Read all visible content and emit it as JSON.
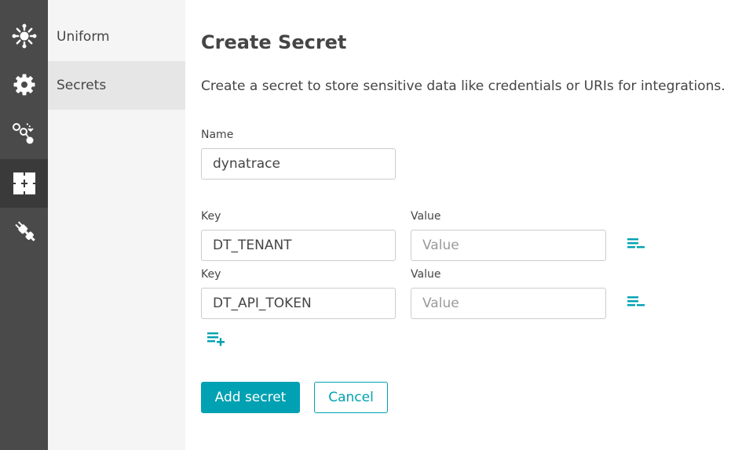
{
  "rail": {
    "items": [
      {
        "icon": "hub-icon"
      },
      {
        "icon": "gear-icon"
      },
      {
        "icon": "workflow-icon"
      },
      {
        "icon": "puzzle-icon"
      },
      {
        "icon": "plug-icon"
      }
    ],
    "active_index": 3
  },
  "subnav": {
    "items": [
      {
        "label": "Uniform"
      },
      {
        "label": "Secrets"
      }
    ],
    "active_index": 1
  },
  "form": {
    "title": "Create Secret",
    "description": "Create a secret to store sensitive data like credentials or URIs for integrations.",
    "name_label": "Name",
    "name_value": "dynatrace",
    "rows": [
      {
        "key_label": "Key",
        "key_value": "DT_TENANT",
        "value_label": "Value",
        "value_placeholder": "Value"
      },
      {
        "key_label": "Key",
        "key_value": "DT_API_TOKEN",
        "value_label": "Value",
        "value_placeholder": "Value"
      }
    ],
    "submit_label": "Add secret",
    "cancel_label": "Cancel"
  },
  "colors": {
    "accent": "#00a1b2",
    "rail_bg": "#4a4a4a",
    "subnav_bg": "#f5f5f5"
  }
}
